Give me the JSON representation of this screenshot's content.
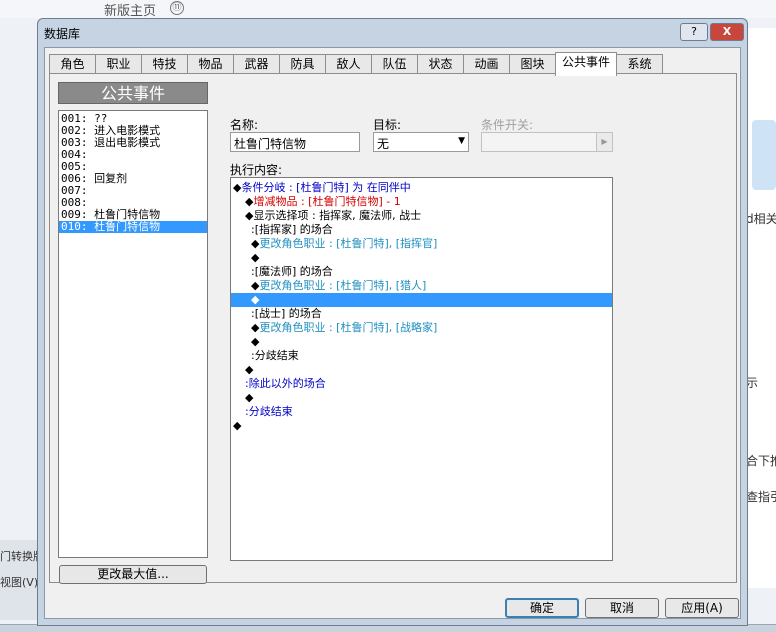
{
  "background": {
    "top_text": "新版主页",
    "top_icon": "⑪",
    "left_texts": [
      "门转换版",
      "视图(V)"
    ],
    "right_texts": [
      "d相关",
      "示",
      "合下推",
      "查指引"
    ]
  },
  "window": {
    "title": "数据库",
    "help_label": "?",
    "close_label": "X"
  },
  "tabs": [
    "角色",
    "职业",
    "特技",
    "物品",
    "武器",
    "防具",
    "敌人",
    "队伍",
    "状态",
    "动画",
    "图块",
    "公共事件",
    "系统"
  ],
  "active_tab": "公共事件",
  "list": {
    "header": "公共事件",
    "items": [
      {
        "id": "001:",
        "name": "??"
      },
      {
        "id": "002:",
        "name": "进入电影模式"
      },
      {
        "id": "003:",
        "name": "退出电影模式"
      },
      {
        "id": "004:",
        "name": ""
      },
      {
        "id": "005:",
        "name": ""
      },
      {
        "id": "006:",
        "name": "回复剂"
      },
      {
        "id": "007:",
        "name": ""
      },
      {
        "id": "008:",
        "name": ""
      },
      {
        "id": "009:",
        "name": "杜鲁门特信物"
      },
      {
        "id": "010:",
        "name": "杜鲁门特信物"
      }
    ],
    "selected_index": 9,
    "max_button": "更改最大值..."
  },
  "form": {
    "name_label": "名称:",
    "name_value": "杜鲁门特信物",
    "target_label": "目标:",
    "target_value": "无",
    "switch_label": "条件开关:",
    "content_label": "执行内容:"
  },
  "commands": [
    {
      "indent": 0,
      "parts": [
        {
          "t": "◆",
          "c": "black"
        },
        {
          "t": "条件分岐 : [杜鲁门特] 为 在同伴中",
          "c": "blue"
        }
      ]
    },
    {
      "indent": 1,
      "parts": [
        {
          "t": "◆",
          "c": "black"
        },
        {
          "t": "增减物品 : [杜鲁门特信物] - 1",
          "c": "red"
        }
      ]
    },
    {
      "indent": 1,
      "parts": [
        {
          "t": "◆",
          "c": "black"
        },
        {
          "t": "显示选择项 : 指挥家, 魔法师, 战士",
          "c": "black"
        }
      ]
    },
    {
      "indent": 2,
      "parts": [
        {
          "t": ":[指挥家] 的场合",
          "c": "black"
        }
      ]
    },
    {
      "indent": 2,
      "parts": [
        {
          "t": "◆",
          "c": "black"
        },
        {
          "t": "更改角色职业 : [杜鲁门特], [指挥官]",
          "c": "teal"
        }
      ]
    },
    {
      "indent": 2,
      "parts": [
        {
          "t": "◆",
          "c": "black"
        }
      ]
    },
    {
      "indent": 2,
      "parts": [
        {
          "t": ":[魔法师] 的场合",
          "c": "black"
        }
      ]
    },
    {
      "indent": 2,
      "parts": [
        {
          "t": "◆",
          "c": "black"
        },
        {
          "t": "更改角色职业 : [杜鲁门特], [猎人]",
          "c": "teal"
        }
      ]
    },
    {
      "indent": 2,
      "parts": [
        {
          "t": "◆",
          "c": "white"
        }
      ],
      "selected": true
    },
    {
      "indent": 2,
      "parts": [
        {
          "t": ":[战士] 的场合",
          "c": "black"
        }
      ]
    },
    {
      "indent": 2,
      "parts": [
        {
          "t": "◆",
          "c": "black"
        },
        {
          "t": "更改角色职业 : [杜鲁门特], [战略家]",
          "c": "teal"
        }
      ]
    },
    {
      "indent": 2,
      "parts": [
        {
          "t": "◆",
          "c": "black"
        }
      ]
    },
    {
      "indent": 2,
      "parts": [
        {
          "t": ":分歧结束",
          "c": "black"
        }
      ]
    },
    {
      "indent": 1,
      "parts": [
        {
          "t": "◆",
          "c": "black"
        }
      ]
    },
    {
      "indent": 1,
      "parts": [
        {
          "t": ":除此以外的场合",
          "c": "blue"
        }
      ]
    },
    {
      "indent": 1,
      "parts": [
        {
          "t": "◆",
          "c": "black"
        }
      ]
    },
    {
      "indent": 1,
      "parts": [
        {
          "t": ":分歧结束",
          "c": "blue"
        }
      ]
    },
    {
      "indent": 0,
      "parts": [
        {
          "t": "◆",
          "c": "black"
        }
      ]
    }
  ],
  "buttons": {
    "ok": "确定",
    "cancel": "取消",
    "apply": "应用(A)"
  }
}
